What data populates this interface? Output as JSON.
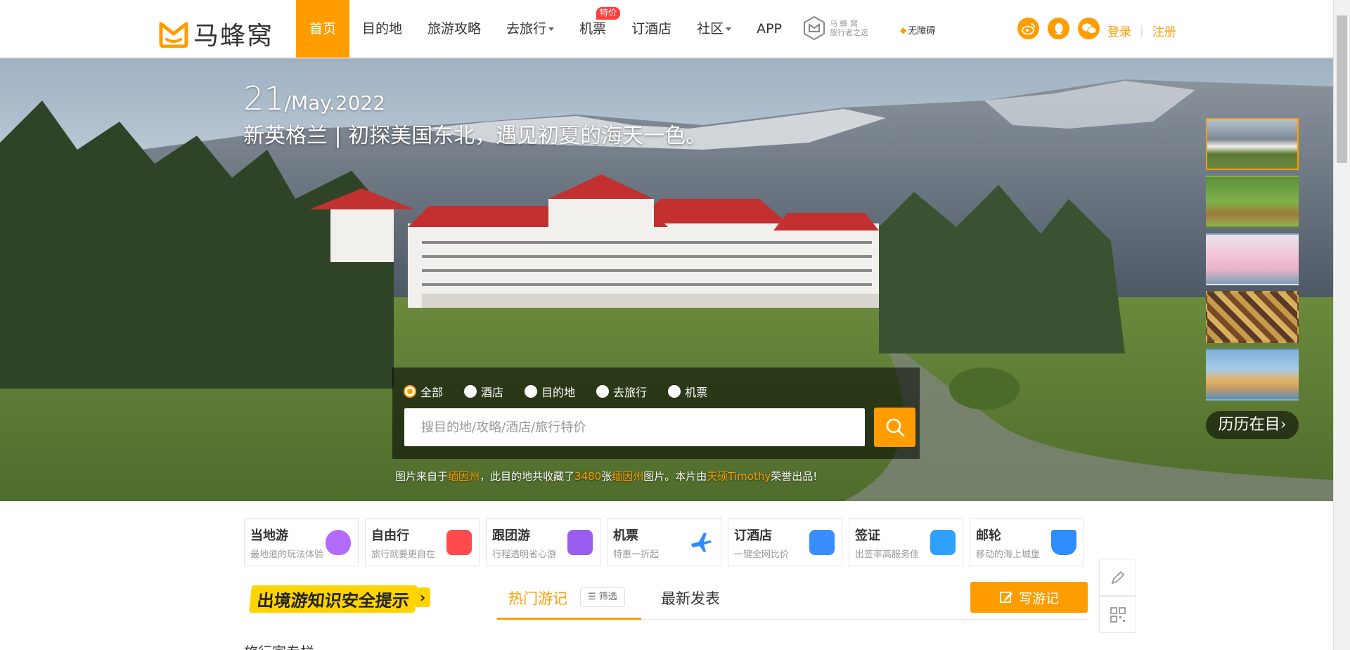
{
  "header": {
    "logo_text": "马蜂窝",
    "nav": [
      {
        "label": "首页",
        "active": true
      },
      {
        "label": "目的地"
      },
      {
        "label": "旅游攻略"
      },
      {
        "label": "去旅行",
        "dropdown": true
      },
      {
        "label": "机票",
        "badge": "特价"
      },
      {
        "label": "订酒店"
      },
      {
        "label": "社区",
        "dropdown": true
      },
      {
        "label": "APP"
      }
    ],
    "seal_line1": "马 蜂 窝",
    "seal_line2": "旅行者之选",
    "accessibility": "无障碍",
    "login": "登录",
    "register": "注册",
    "social_icons": [
      "weibo-icon",
      "qq-icon",
      "wechat-icon"
    ]
  },
  "hero": {
    "day": "21",
    "month_year": "/May.2022",
    "title": "新英格兰 | 初探美国东北，遇见初夏的海天一色。",
    "history_label": "历历在目›",
    "search": {
      "options": [
        {
          "label": "全部",
          "checked": true
        },
        {
          "label": "酒店"
        },
        {
          "label": "目的地"
        },
        {
          "label": "去旅行"
        },
        {
          "label": "机票"
        }
      ],
      "placeholder": "搜目的地/攻略/酒店/旅行特价"
    },
    "credit": {
      "p1": "图片来自于",
      "place": "缅因州",
      "p2": "，此目的地共收藏了",
      "count": "3480",
      "p3": "张",
      "place2": "缅因州",
      "p4": "图片。本片由",
      "author": "天硕Timothy",
      "p5": "荣誉出品!"
    }
  },
  "services": [
    {
      "title": "当地游",
      "sub": "最地道的玩法体验",
      "icon": "balloon-icon",
      "color": "#b36bff"
    },
    {
      "title": "自由行",
      "sub": "旅行就要更自在",
      "icon": "gift-icon",
      "color": "#ff4b4b"
    },
    {
      "title": "跟团游",
      "sub": "行程透明省心游",
      "icon": "flag-icon",
      "color": "#9b5cf0"
    },
    {
      "title": "机票",
      "sub": "特惠一折起",
      "icon": "plane-icon",
      "color": "#2f8cff"
    },
    {
      "title": "订酒店",
      "sub": "一键全网比价",
      "icon": "building-icon",
      "color": "#3a8dff"
    },
    {
      "title": "签证",
      "sub": "出签率高服务佳",
      "icon": "passport-icon",
      "color": "#2fa0ff"
    },
    {
      "title": "邮轮",
      "sub": "移动的海上城堡",
      "icon": "ship-icon",
      "color": "#2f8cff"
    }
  ],
  "section": {
    "safety_notice": "出境游知识安全提示",
    "tab_hot": "热门游记",
    "filter": "筛选",
    "tab_latest": "最新发表",
    "write": "写游记",
    "peek": "旅行家专栏"
  }
}
